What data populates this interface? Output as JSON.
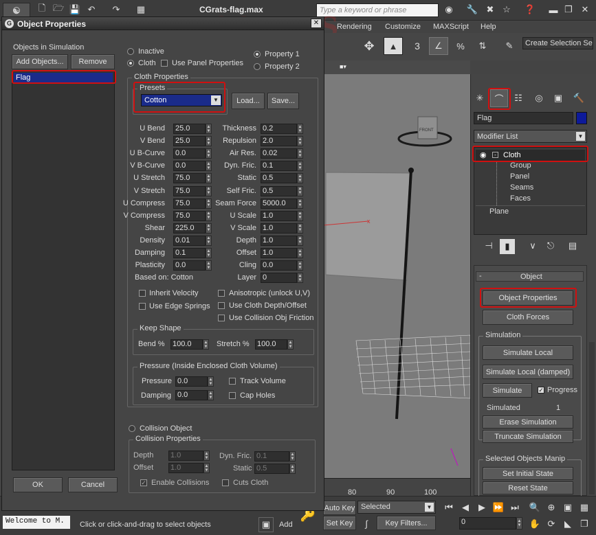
{
  "app": {
    "title": "CGrats-flag.max",
    "search_placeholder": "Type a keyword or phrase",
    "watermark": "CGRATS"
  },
  "menu": [
    "Rendering",
    "Customize",
    "MAXScript",
    "Help"
  ],
  "toolbar": {
    "create_selection": "Create Selection Se"
  },
  "dialog": {
    "title": "Object Properties",
    "objects_label": "Objects in Simulation",
    "add_objects": "Add Objects...",
    "remove": "Remove",
    "objects": [
      "Flag"
    ],
    "ok": "OK",
    "cancel": "Cancel",
    "mode": {
      "inactive": "Inactive",
      "cloth": "Cloth",
      "use_panel": "Use Panel Properties",
      "property1": "Property 1",
      "property2": "Property 2"
    },
    "cloth_props_title": "Cloth Properties",
    "presets_title": "Presets",
    "preset_value": "Cotton",
    "load": "Load...",
    "save": "Save...",
    "left_params": [
      {
        "label": "U Bend",
        "value": "25.0"
      },
      {
        "label": "V Bend",
        "value": "25.0"
      },
      {
        "label": "U B-Curve",
        "value": "0.0"
      },
      {
        "label": "V B-Curve",
        "value": "0.0"
      },
      {
        "label": "U Stretch",
        "value": "75.0"
      },
      {
        "label": "V Stretch",
        "value": "75.0"
      },
      {
        "label": "U Compress",
        "value": "75.0"
      },
      {
        "label": "V Compress",
        "value": "75.0"
      },
      {
        "label": "Shear",
        "value": "225.0"
      },
      {
        "label": "Density",
        "value": "0.01"
      },
      {
        "label": "Damping",
        "value": "0.1"
      },
      {
        "label": "Plasticity",
        "value": "0.0"
      }
    ],
    "right_params": [
      {
        "label": "Thickness",
        "value": "0.2"
      },
      {
        "label": "Repulsion",
        "value": "2.0"
      },
      {
        "label": "Air Res.",
        "value": "0.02"
      },
      {
        "label": "Dyn. Fric.",
        "value": "0.1"
      },
      {
        "label": "Static",
        "value": "0.5"
      },
      {
        "label": "Self Fric.",
        "value": "0.5"
      },
      {
        "label": "Seam Force",
        "value": "5000.0"
      },
      {
        "label": "U Scale",
        "value": "1.0"
      },
      {
        "label": "V Scale",
        "value": "1.0"
      },
      {
        "label": "Depth",
        "value": "1.0"
      },
      {
        "label": "Offset",
        "value": "1.0"
      },
      {
        "label": "Cling",
        "value": "0.0"
      },
      {
        "label": "Layer",
        "value": "0"
      }
    ],
    "based_on": "Based on: Cotton",
    "checks": {
      "inherit_velocity": "Inherit Velocity",
      "anisotropic": "Anisotropic (unlock U,V)",
      "use_edge_springs": "Use Edge Springs",
      "use_cloth_depth": "Use Cloth Depth/Offset",
      "use_collision_friction": "Use Collision Obj Friction"
    },
    "keep_shape": {
      "title": "Keep Shape",
      "bend_label": "Bend %",
      "bend_value": "100.0",
      "stretch_label": "Stretch %",
      "stretch_value": "100.0"
    },
    "pressure": {
      "title": "Pressure (Inside Enclosed Cloth Volume)",
      "pressure_label": "Pressure",
      "pressure_value": "0.0",
      "damping_label": "Damping",
      "damping_value": "0.0",
      "track_volume": "Track Volume",
      "cap_holes": "Cap Holes"
    },
    "collision_object": "Collision Object",
    "collision": {
      "title": "Collision Properties",
      "depth_label": "Depth",
      "depth_value": "1.0",
      "offset_label": "Offset",
      "offset_value": "1.0",
      "dyn_fric_label": "Dyn. Fric.",
      "dyn_fric_value": "0.1",
      "static_label": "Static",
      "static_value": "0.5",
      "enable_collisions": "Enable Collisions",
      "cuts_cloth": "Cuts Cloth"
    }
  },
  "cmdpanel": {
    "object_name": "Flag",
    "modifier_list": "Modifier List",
    "stack": {
      "cloth": "Cloth",
      "group": "Group",
      "panel": "Panel",
      "seams": "Seams",
      "faces": "Faces",
      "plane": "Plane"
    },
    "rollout_title": "Object",
    "object_properties": "Object Properties",
    "cloth_forces": "Cloth Forces",
    "simulation_title": "Simulation",
    "simulate_local": "Simulate Local",
    "simulate_local_damped": "Simulate Local (damped)",
    "simulate": "Simulate",
    "progress": "Progress",
    "simulated_label": "Simulated",
    "simulated_value": "1",
    "erase_simulation": "Erase Simulation",
    "truncate_simulation": "Truncate Simulation",
    "selected_objects_manip": "Selected Objects Manip",
    "set_initial_state": "Set Initial State",
    "reset_state": "Reset State"
  },
  "viewport": {
    "front_label": "FRONT",
    "ruler": [
      "80",
      "90",
      "100"
    ]
  },
  "bottom": {
    "welcome": "Welcome to M.",
    "status": "Click or click-and-drag to select objects",
    "auto_key": "Auto Key",
    "set_key": "Set Key",
    "selected": "Selected",
    "key_filters": "Key Filters...",
    "add": "Add",
    "frame": "0"
  },
  "colors": {
    "highlight": "#d01010",
    "selection": "#1a2b8a",
    "panel": "#454545"
  }
}
